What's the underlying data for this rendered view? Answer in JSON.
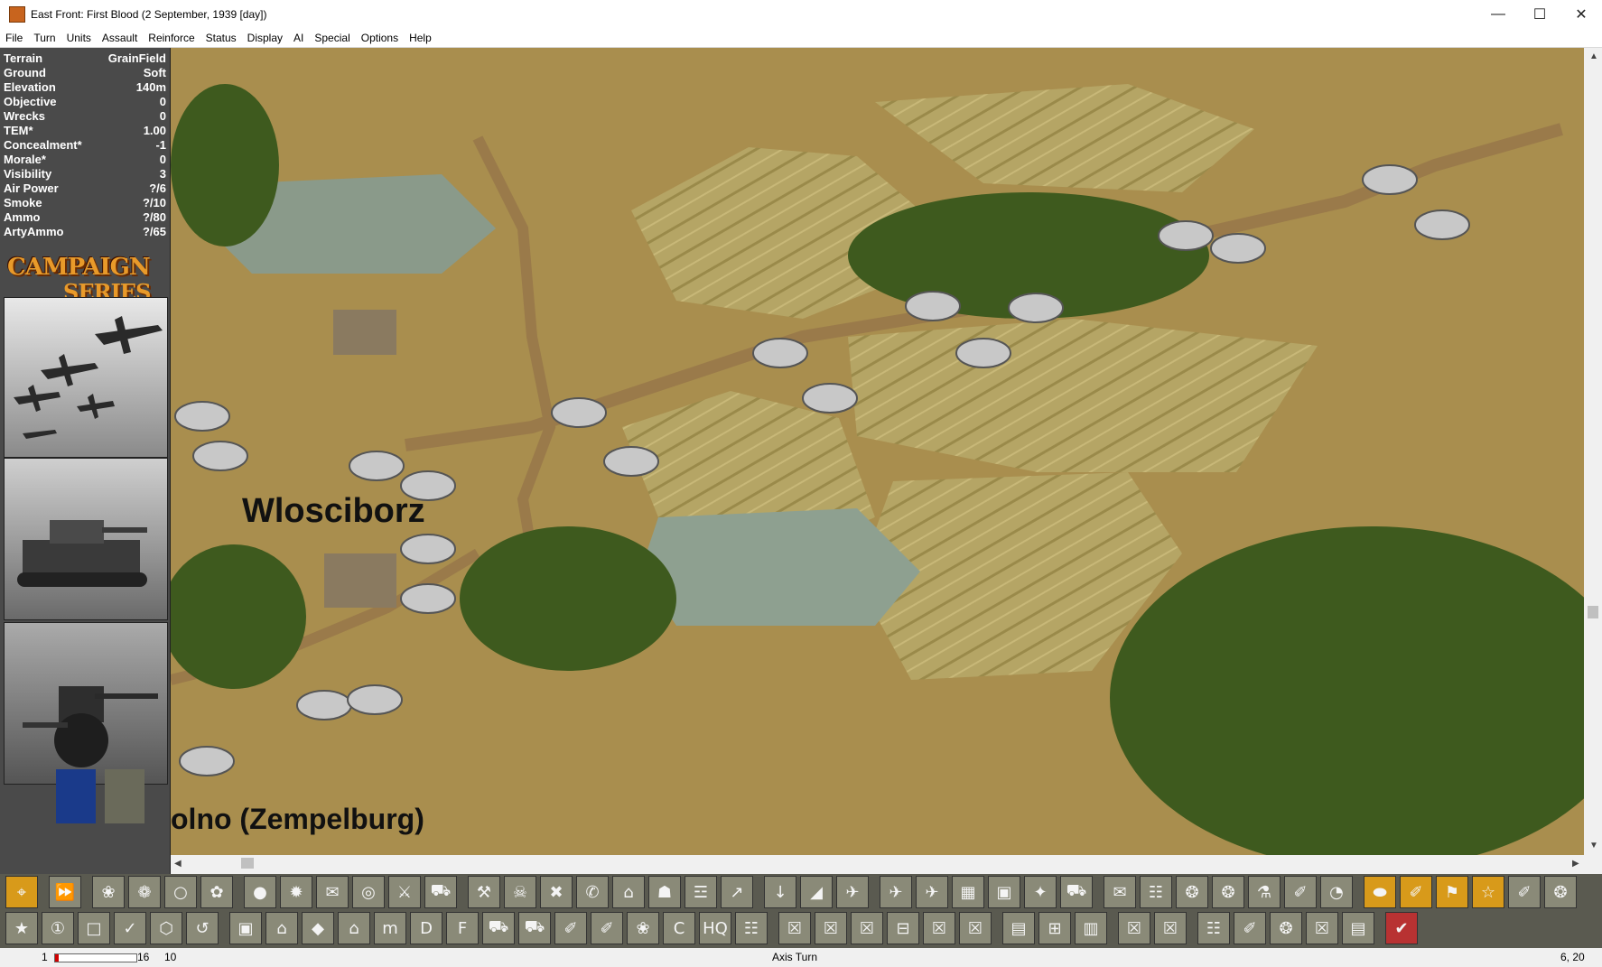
{
  "window": {
    "title": "East Front: First Blood (2 September, 1939 [day])",
    "minimize": "—",
    "maximize": "☐",
    "close": "✕"
  },
  "menu": [
    "File",
    "Turn",
    "Units",
    "Assault",
    "Reinforce",
    "Status",
    "Display",
    "AI",
    "Special",
    "Options",
    "Help"
  ],
  "info": [
    {
      "label": "Terrain",
      "value": "GrainField"
    },
    {
      "label": "Ground",
      "value": "Soft"
    },
    {
      "label": "Elevation",
      "value": "140m"
    },
    {
      "label": "Objective",
      "value": "0"
    },
    {
      "label": "Wrecks",
      "value": "0"
    },
    {
      "label": "TEM*",
      "value": "1.00"
    },
    {
      "label": "Concealment*",
      "value": "-1"
    },
    {
      "label": "Morale*",
      "value": "0"
    },
    {
      "label": "Visibility",
      "value": "3"
    },
    {
      "label": "Air Power",
      "value": "?/6"
    },
    {
      "label": "Smoke",
      "value": "?/10"
    },
    {
      "label": "Ammo",
      "value": "?/80"
    },
    {
      "label": "ArtyAmmo",
      "value": "?/65"
    }
  ],
  "logo": {
    "line1": "CAMPAIGN",
    "line2": "SERIES"
  },
  "map": {
    "labels": [
      {
        "text": "Wlosciborz"
      },
      {
        "text": "olno (Zempelburg)"
      }
    ]
  },
  "toolbar": {
    "row1": [
      "⌖",
      "⏩",
      "❀",
      "❁",
      "○",
      "✿",
      "●",
      "✹",
      "✉",
      "◎",
      "⚔",
      "⛟",
      "⚒",
      "☠",
      "✖",
      "✆",
      "⌂",
      "☗",
      "☲",
      "↗",
      "↓",
      "◢",
      "✈",
      "✈",
      "✈",
      "▦",
      "▣",
      "✦",
      "⛟",
      "✉",
      "☷",
      "❂",
      "❂",
      "⚗",
      "✐",
      "◔",
      "⬬",
      "✐",
      "⚑",
      "☆",
      "✐",
      "❂"
    ],
    "row2": [
      "★",
      "①",
      "□",
      "✓",
      "⬡",
      "↺",
      "▣",
      "⌂",
      "◆",
      "⌂",
      "m",
      "D",
      "F",
      "⛟",
      "⛟",
      "✐",
      "✐",
      "❀",
      "C",
      "HQ",
      "☷",
      "☒",
      "☒",
      "☒",
      "⊟",
      "☒",
      "☒",
      "▤",
      "⊞",
      "▥",
      "☒",
      "☒",
      "☷",
      "✐",
      "❂",
      "☒",
      "▤",
      "✔"
    ]
  },
  "status": {
    "left": "1",
    "max": "16",
    "ammo": "10",
    "fill": 0.04,
    "turn": "Axis Turn",
    "coord": "6, 20"
  }
}
